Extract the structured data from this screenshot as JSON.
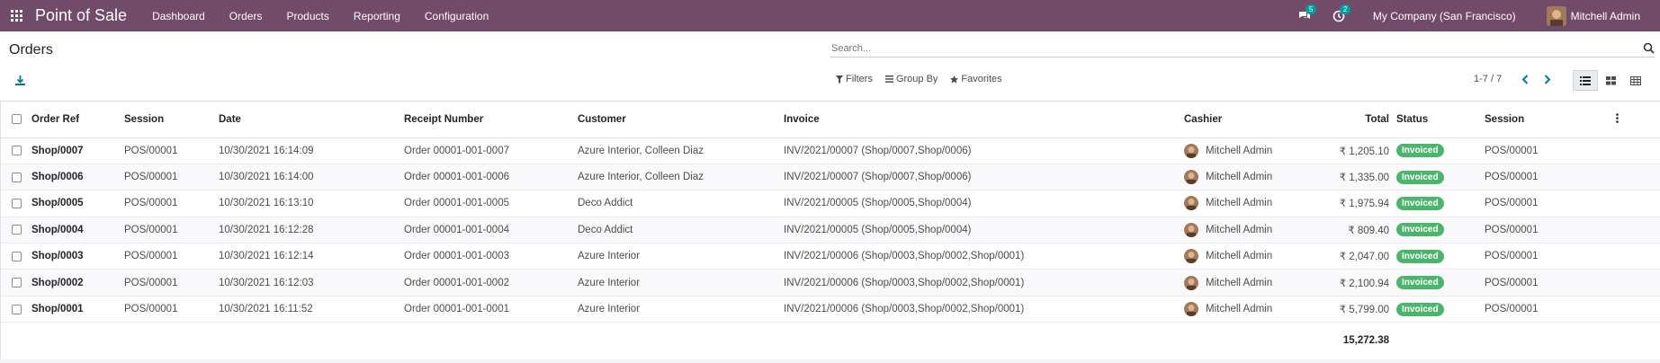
{
  "nav": {
    "app_title": "Point of Sale",
    "menu": [
      "Dashboard",
      "Orders",
      "Products",
      "Reporting",
      "Configuration"
    ],
    "messages_count": "5",
    "activities_count": "2",
    "company": "My Company (San Francisco)",
    "user": "Mitchell Admin",
    "accent_color": "#714b67"
  },
  "control": {
    "title": "Orders",
    "search_placeholder": "Search...",
    "filters_label": "Filters",
    "groupby_label": "Group By",
    "favorites_label": "Favorites",
    "pager": "1-7 / 7"
  },
  "table": {
    "headers": [
      "Order Ref",
      "Session",
      "Date",
      "Receipt Number",
      "Customer",
      "Invoice",
      "Cashier",
      "Total",
      "Status",
      "Session"
    ],
    "rows": [
      {
        "ref": "Shop/0007",
        "session": "POS/00001",
        "date": "10/30/2021 16:14:09",
        "receipt": "Order 00001-001-0007",
        "customer": "Azure Interior, Colleen Diaz",
        "invoice": "INV/2021/00007 (Shop/0007,Shop/0006)",
        "cashier": "Mitchell Admin",
        "total": "₹ 1,205.10",
        "status": "Invoiced",
        "session2": "POS/00001"
      },
      {
        "ref": "Shop/0006",
        "session": "POS/00001",
        "date": "10/30/2021 16:14:00",
        "receipt": "Order 00001-001-0006",
        "customer": "Azure Interior, Colleen Diaz",
        "invoice": "INV/2021/00007 (Shop/0007,Shop/0006)",
        "cashier": "Mitchell Admin",
        "total": "₹ 1,335.00",
        "status": "Invoiced",
        "session2": "POS/00001"
      },
      {
        "ref": "Shop/0005",
        "session": "POS/00001",
        "date": "10/30/2021 16:13:10",
        "receipt": "Order 00001-001-0005",
        "customer": "Deco Addict",
        "invoice": "INV/2021/00005 (Shop/0005,Shop/0004)",
        "cashier": "Mitchell Admin",
        "total": "₹ 1,975.94",
        "status": "Invoiced",
        "session2": "POS/00001"
      },
      {
        "ref": "Shop/0004",
        "session": "POS/00001",
        "date": "10/30/2021 16:12:28",
        "receipt": "Order 00001-001-0004",
        "customer": "Deco Addict",
        "invoice": "INV/2021/00005 (Shop/0005,Shop/0004)",
        "cashier": "Mitchell Admin",
        "total": "₹ 809.40",
        "status": "Invoiced",
        "session2": "POS/00001"
      },
      {
        "ref": "Shop/0003",
        "session": "POS/00001",
        "date": "10/30/2021 16:12:14",
        "receipt": "Order 00001-001-0003",
        "customer": "Azure Interior",
        "invoice": "INV/2021/00006 (Shop/0003,Shop/0002,Shop/0001)",
        "cashier": "Mitchell Admin",
        "total": "₹ 2,047.00",
        "status": "Invoiced",
        "session2": "POS/00001"
      },
      {
        "ref": "Shop/0002",
        "session": "POS/00001",
        "date": "10/30/2021 16:12:03",
        "receipt": "Order 00001-001-0002",
        "customer": "Azure Interior",
        "invoice": "INV/2021/00006 (Shop/0003,Shop/0002,Shop/0001)",
        "cashier": "Mitchell Admin",
        "total": "₹ 2,100.94",
        "status": "Invoiced",
        "session2": "POS/00001"
      },
      {
        "ref": "Shop/0001",
        "session": "POS/00001",
        "date": "10/30/2021 16:11:52",
        "receipt": "Order 00001-001-0001",
        "customer": "Azure Interior",
        "invoice": "INV/2021/00006 (Shop/0003,Shop/0002,Shop/0001)",
        "cashier": "Mitchell Admin",
        "total": "₹ 5,799.00",
        "status": "Invoiced",
        "session2": "POS/00001"
      }
    ],
    "grand_total": "15,272.38"
  }
}
